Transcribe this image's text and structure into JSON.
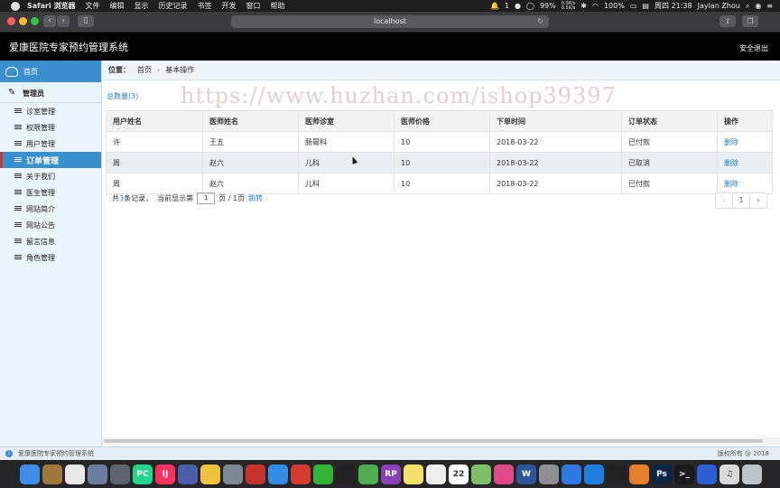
{
  "menubar": {
    "app_name": "Safari 浏览器",
    "menus": [
      "文件",
      "编辑",
      "显示",
      "历史记录",
      "书签",
      "开发",
      "窗口",
      "帮助"
    ],
    "notif_count": "1",
    "battery": "99%",
    "net_up": "0.0K/s",
    "net_down": "0.5K/s",
    "charge": "100%",
    "clock": "周四 21:38",
    "user": "Jaylan Zhou"
  },
  "browser": {
    "url": "localhost",
    "reload_glyph": "↻",
    "back_glyph": "‹",
    "forward_glyph": "›"
  },
  "app": {
    "title": "爱康医院专家预约管理系统",
    "logout": "安全退出"
  },
  "sidebar": {
    "home": "首页",
    "group": "管理员",
    "items": [
      {
        "label": "诊室管理"
      },
      {
        "label": "权限管理"
      },
      {
        "label": "用户管理"
      },
      {
        "label": "订单管理",
        "active": true
      },
      {
        "label": "关于我们"
      },
      {
        "label": "医生管理"
      },
      {
        "label": "网站简介"
      },
      {
        "label": "网站公告"
      },
      {
        "label": "留言信息"
      },
      {
        "label": "角色管理"
      }
    ]
  },
  "breadcrumb": {
    "prefix": "位置：",
    "home": "首页",
    "sep": "›",
    "current": "基本操作"
  },
  "summary": {
    "total_label": "总数量(3)"
  },
  "watermark": "https://www.huzhan.com/ishop39397",
  "table": {
    "headers": [
      "用户姓名",
      "医师姓名",
      "医师诊室",
      "医师价格",
      "下单时间",
      "订单状态",
      "操作"
    ],
    "rows": [
      [
        "许",
        "王五",
        "肠胃科",
        "10",
        "2018-03-22",
        "已付款",
        "删除"
      ],
      [
        "周",
        "赵六",
        "儿科",
        "10",
        "2018-03-22",
        "已取消",
        "删除"
      ],
      [
        "周",
        "赵六",
        "儿科",
        "10",
        "2018-03-22",
        "已付款",
        "删除"
      ]
    ]
  },
  "pagination": {
    "text_pre": "共",
    "count": "3",
    "text_mid": "条记录，  当前显示第",
    "page_input": "1",
    "text_post": "页 / 1页",
    "jump": "跳转",
    "prev": "‹",
    "current": "1",
    "next": "›"
  },
  "status": {
    "info_glyph": "i",
    "text": "爱康医院专家预约管理系统",
    "copyright": "版权所有 @ 2018"
  },
  "dock": {
    "apps": [
      {
        "name": "finder",
        "color": "#3d8ee8",
        "glyph": ""
      },
      {
        "name": "notes-app",
        "color": "#a0783c",
        "glyph": ""
      },
      {
        "name": "photos",
        "color": "#e8e8e8",
        "glyph": ""
      },
      {
        "name": "preview",
        "color": "#6c7ea0",
        "glyph": ""
      },
      {
        "name": "launchpad",
        "color": "#5d6470",
        "glyph": ""
      },
      {
        "name": "pycharm",
        "color": "#21d789",
        "glyph": "PC"
      },
      {
        "name": "intellij",
        "color": "#fe315d",
        "glyph": "IJ"
      },
      {
        "name": "sublime-ext",
        "color": "#4b5fa8",
        "glyph": ""
      },
      {
        "name": "sequel",
        "color": "#f0c13c",
        "glyph": ""
      },
      {
        "name": "db-tool",
        "color": "#7b8894",
        "glyph": ""
      },
      {
        "name": "redis",
        "color": "#c7332c",
        "glyph": ""
      },
      {
        "name": "safari",
        "color": "#2f8fe6",
        "glyph": ""
      },
      {
        "name": "netease-music",
        "color": "#d63b2f",
        "glyph": ""
      },
      {
        "name": "wechat",
        "color": "#33b433",
        "glyph": ""
      },
      {
        "name": "qq",
        "color": "#222222",
        "glyph": ""
      },
      {
        "name": "chrome-like",
        "color": "#4cae4f",
        "glyph": ""
      },
      {
        "name": "axure-rp",
        "color": "#8b3fb8",
        "glyph": "RP"
      },
      {
        "name": "stickies",
        "color": "#f5e06a",
        "glyph": ""
      },
      {
        "name": "textedit",
        "color": "#eeeeee",
        "glyph": ""
      },
      {
        "name": "calendar",
        "color": "#ffffff",
        "glyph": "22"
      },
      {
        "name": "maps",
        "color": "#7fbf6a",
        "glyph": ""
      },
      {
        "name": "itunes",
        "color": "#e04a8a",
        "glyph": ""
      },
      {
        "name": "word",
        "color": "#2b579a",
        "glyph": "W"
      },
      {
        "name": "system-prefs",
        "color": "#8e8e93",
        "glyph": ""
      },
      {
        "name": "baidu-netdisk",
        "color": "#2f78e4",
        "glyph": ""
      },
      {
        "name": "teamviewer",
        "color": "#1f7fe0",
        "glyph": ""
      },
      {
        "name": "qq-2",
        "color": "#222222",
        "glyph": ""
      },
      {
        "name": "sublime-text",
        "color": "#e57e2d",
        "glyph": ""
      },
      {
        "name": "photoshop",
        "color": "#0b2642",
        "glyph": "Ps"
      },
      {
        "name": "terminal",
        "color": "#1b1b1b",
        "glyph": ">_"
      },
      {
        "name": "browser-2",
        "color": "#2a5fd6",
        "glyph": ""
      },
      {
        "name": "music-folder",
        "color": "#d9d9d9",
        "glyph": "♫"
      },
      {
        "name": "trash",
        "color": "#bfc3c8",
        "glyph": ""
      }
    ]
  }
}
